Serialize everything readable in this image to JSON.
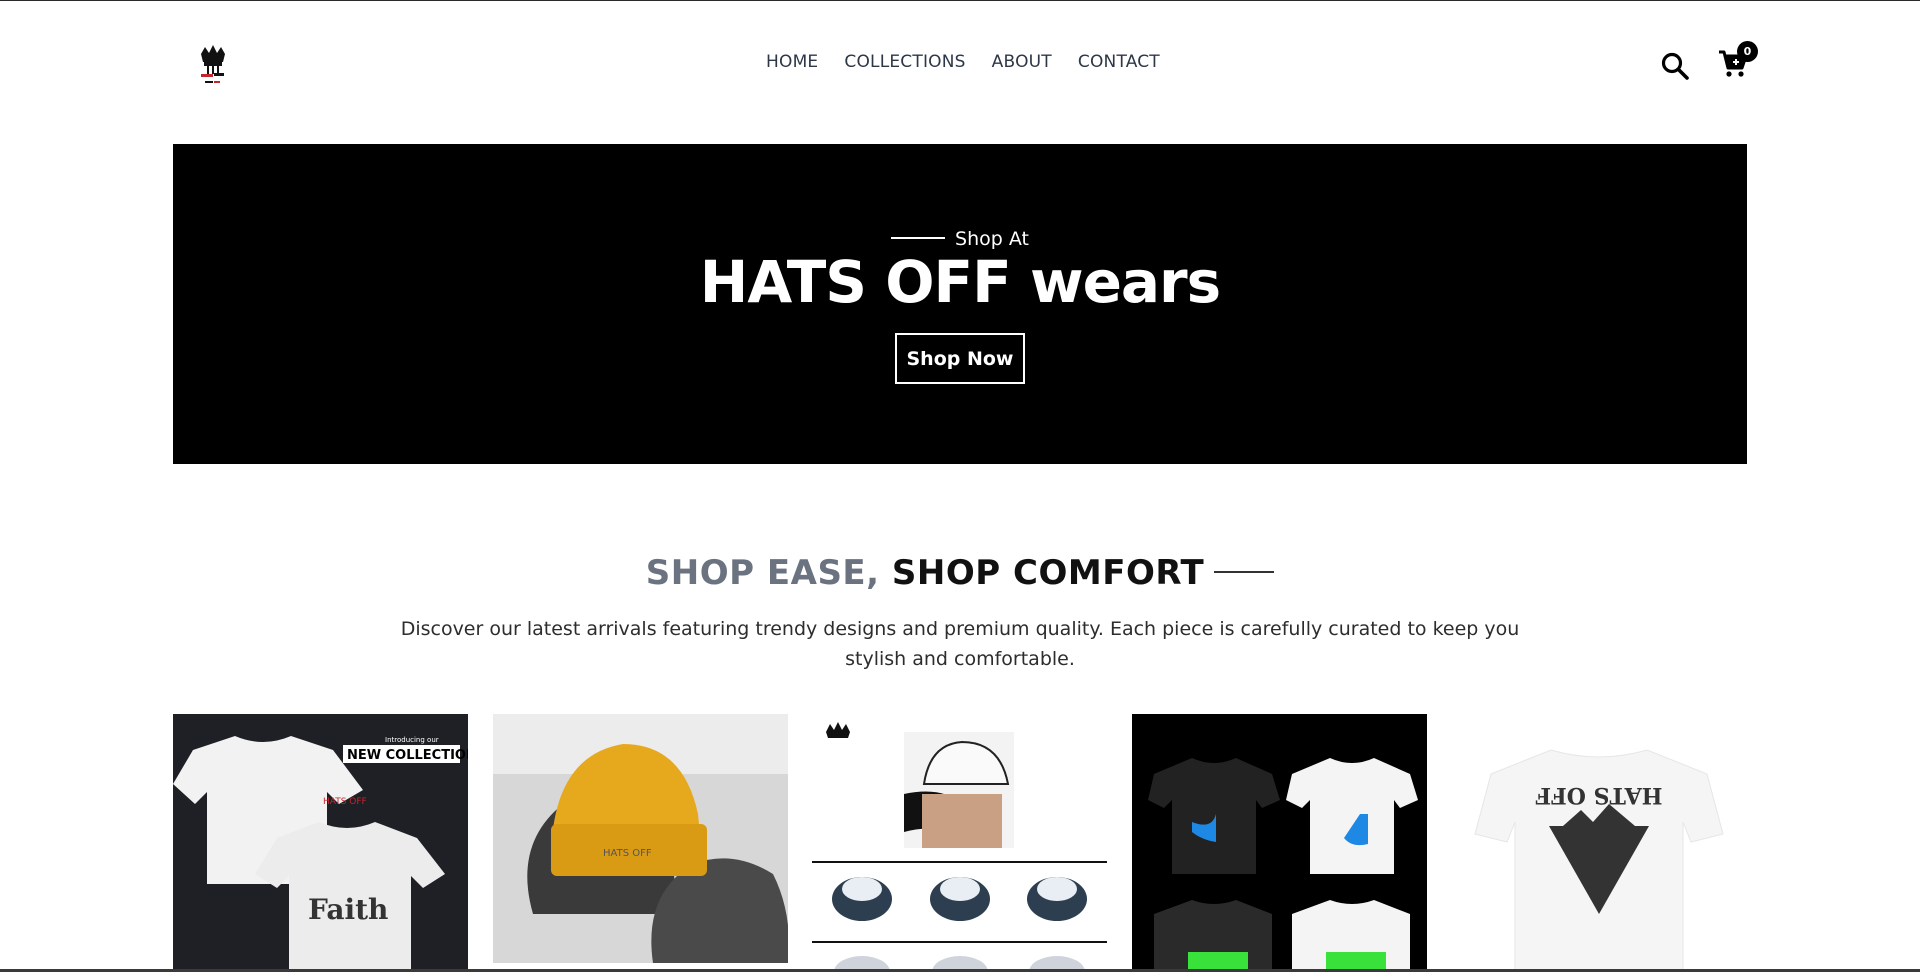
{
  "header": {
    "nav": [
      {
        "label": "HOME"
      },
      {
        "label": "COLLECTIONS"
      },
      {
        "label": "ABOUT"
      },
      {
        "label": "CONTACT"
      }
    ],
    "cart_count": "0",
    "icons": {
      "search": "search-icon",
      "cart": "cart-icon"
    }
  },
  "hero": {
    "kicker": "Shop At",
    "title": "HATS OFF wears",
    "button": "Shop Now"
  },
  "section": {
    "heading_muted": "SHOP EASE,",
    "heading_strong": "SHOP COMFORT",
    "description": "Discover our latest arrivals featuring trendy designs and premium quality. Each piece is carefully curated to keep you stylish and comfortable."
  },
  "products": {
    "p1": {
      "overlay_small": "Introducing our",
      "overlay_big": "NEW COLLECTION",
      "print": "Faith"
    },
    "p5": {
      "print": "HATS OFF"
    }
  }
}
